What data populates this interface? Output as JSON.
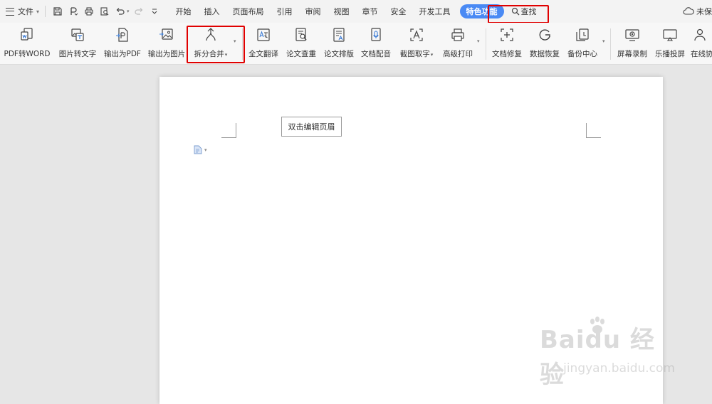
{
  "app": {
    "menu_file": "文件",
    "cloud_status": "未保"
  },
  "quick_access": {
    "icons": [
      "save-icon",
      "export-pdf-icon",
      "print-icon",
      "print-preview-icon",
      "undo-icon",
      "redo-icon",
      "customize-icon"
    ]
  },
  "tabs": [
    {
      "label": "开始"
    },
    {
      "label": "插入"
    },
    {
      "label": "页面布局"
    },
    {
      "label": "引用"
    },
    {
      "label": "审阅"
    },
    {
      "label": "视图"
    },
    {
      "label": "章节"
    },
    {
      "label": "安全"
    },
    {
      "label": "开发工具"
    },
    {
      "label": "特色功能",
      "active": true
    }
  ],
  "search_tab": "查找",
  "ribbon": {
    "buttons": [
      {
        "label": "PDF转WORD",
        "icon": "pdf-to-word-icon"
      },
      {
        "label": "图片转文字",
        "icon": "image-to-text-icon"
      },
      {
        "label": "输出为PDF",
        "icon": "export-pdf-icon"
      },
      {
        "label": "输出为图片",
        "icon": "export-image-icon"
      },
      {
        "label": "拆分合并",
        "icon": "split-merge-icon",
        "dropdown": true
      },
      {
        "label": "全文翻译",
        "icon": "translate-icon"
      },
      {
        "label": "论文查重",
        "icon": "plagiarism-check-icon"
      },
      {
        "label": "论文排版",
        "icon": "thesis-format-icon"
      },
      {
        "label": "文档配音",
        "icon": "voice-icon"
      },
      {
        "label": "截图取字",
        "icon": "screenshot-ocr-icon",
        "dropdown": true
      },
      {
        "label": "高级打印",
        "icon": "advanced-print-icon"
      },
      {
        "label": "文档修复",
        "icon": "doc-repair-icon"
      },
      {
        "label": "数据恢复",
        "icon": "data-recovery-icon"
      },
      {
        "label": "备份中心",
        "icon": "backup-center-icon"
      },
      {
        "label": "屏幕录制",
        "icon": "screen-record-icon"
      },
      {
        "label": "乐播投屏",
        "icon": "cast-screen-icon"
      },
      {
        "label": "在线协",
        "icon": "online-collab-icon"
      }
    ]
  },
  "document": {
    "header_hint": "双击编辑页眉"
  },
  "watermark": {
    "brand": "Baidu 经验",
    "url": "jingyan.baidu.com"
  },
  "colors": {
    "active_tab": "#4a8af4",
    "highlight_box": "#e00000",
    "icon_stroke": "#444444",
    "icon_accent": "#3a7bd5"
  }
}
